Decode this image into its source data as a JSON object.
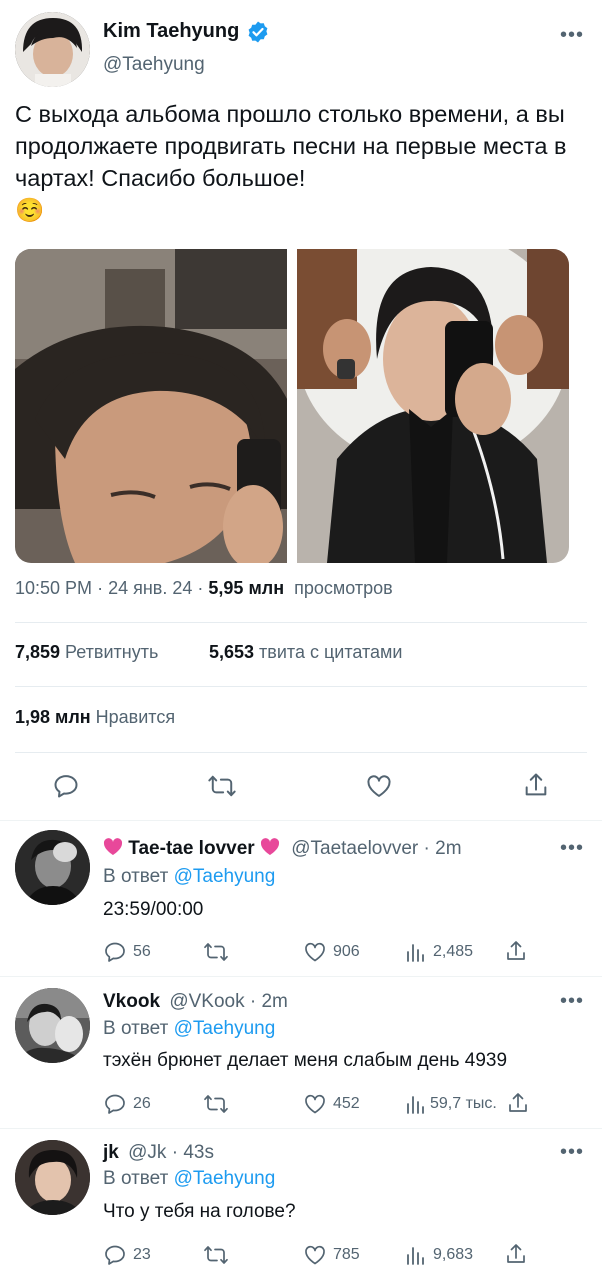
{
  "main_tweet": {
    "display_name": "Kim Taehyung",
    "handle": "@Taehyung",
    "text": "С выхода альбома прошло столько времени, а вы продолжаете продвигать песни на первые места в чартах! Спасибо большое!",
    "emoji": "☺️",
    "time": "10:50 PM",
    "date": "24 янв. 24",
    "views_value": "5,95 млн",
    "views_label": "просмотров",
    "retweets_value": "7,859",
    "retweets_label": "Ретвитнуть",
    "quotes_value": "5,653",
    "quotes_label": "твита с цитатами",
    "likes_value": "1,98 млн",
    "likes_label": "Нравится",
    "more_icon": "more-dots-icon",
    "verified_color": "#1d9bf0"
  },
  "replies": [
    {
      "display_name": "Tae-tae lovver",
      "name_emoji": "💗",
      "handle": "@Taetaelovver",
      "time": "2m",
      "reply_prefix": "В ответ",
      "reply_to": "@Taehyung",
      "text": "23:59/00:00",
      "replies_count": "56",
      "likes_count": "906",
      "views_count": "2,485"
    },
    {
      "display_name": "Vkook",
      "handle": "@VKook",
      "time": "2m",
      "reply_prefix": "В ответ",
      "reply_to": "@Taehyung",
      "text": "тэхён брюнет делает меня слабым день 4939",
      "replies_count": "26",
      "likes_count": "452",
      "views_count": "59,7 тыс."
    },
    {
      "display_name": "jk",
      "handle": "@Jk",
      "time": "43s",
      "reply_prefix": "В ответ",
      "reply_to": "@Taehyung",
      "text": "Что у тебя на голове?",
      "replies_count": "23",
      "likes_count": "785",
      "views_count": "9,683"
    }
  ],
  "colors": {
    "accent": "#1d9bf0",
    "text_secondary": "#536471",
    "heart_emoji": "#e8489a"
  }
}
